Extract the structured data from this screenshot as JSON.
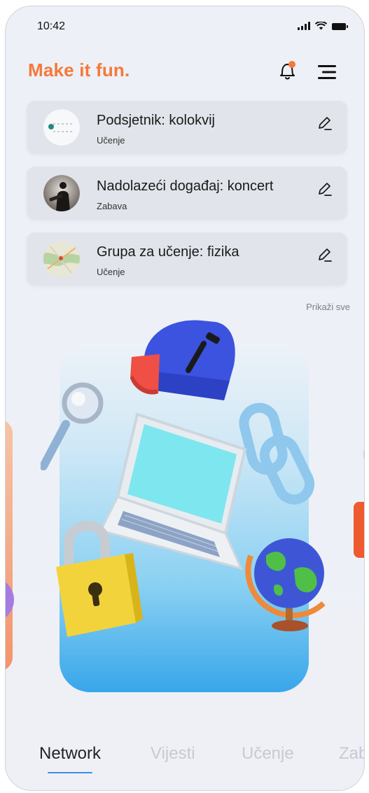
{
  "status_bar": {
    "time": "10:42"
  },
  "header": {
    "brand": "Make it fun."
  },
  "icons": {
    "notification": "bell-icon",
    "menu": "menu-icon",
    "edit": "pencil-icon"
  },
  "colors": {
    "brand": "#f5793a",
    "accent": "#3a8fe2",
    "notification_dot": "#f5793a"
  },
  "notifications": [
    {
      "title": "Podsjetnik: kolokvij",
      "tag": "Učenje",
      "thumb": "calendar"
    },
    {
      "title": "Nadolazeći događaj: koncert",
      "tag": "Zabava",
      "thumb": "concert-photo"
    },
    {
      "title": "Grupa za učenje: fizika",
      "tag": "Učenje",
      "thumb": "map"
    }
  ],
  "show_all": "Prikaži sve",
  "tabs": [
    {
      "label": "Network",
      "active": true
    },
    {
      "label": "Vijesti",
      "active": false
    },
    {
      "label": "Učenje",
      "active": false
    },
    {
      "label": "Zab",
      "active": false
    }
  ]
}
